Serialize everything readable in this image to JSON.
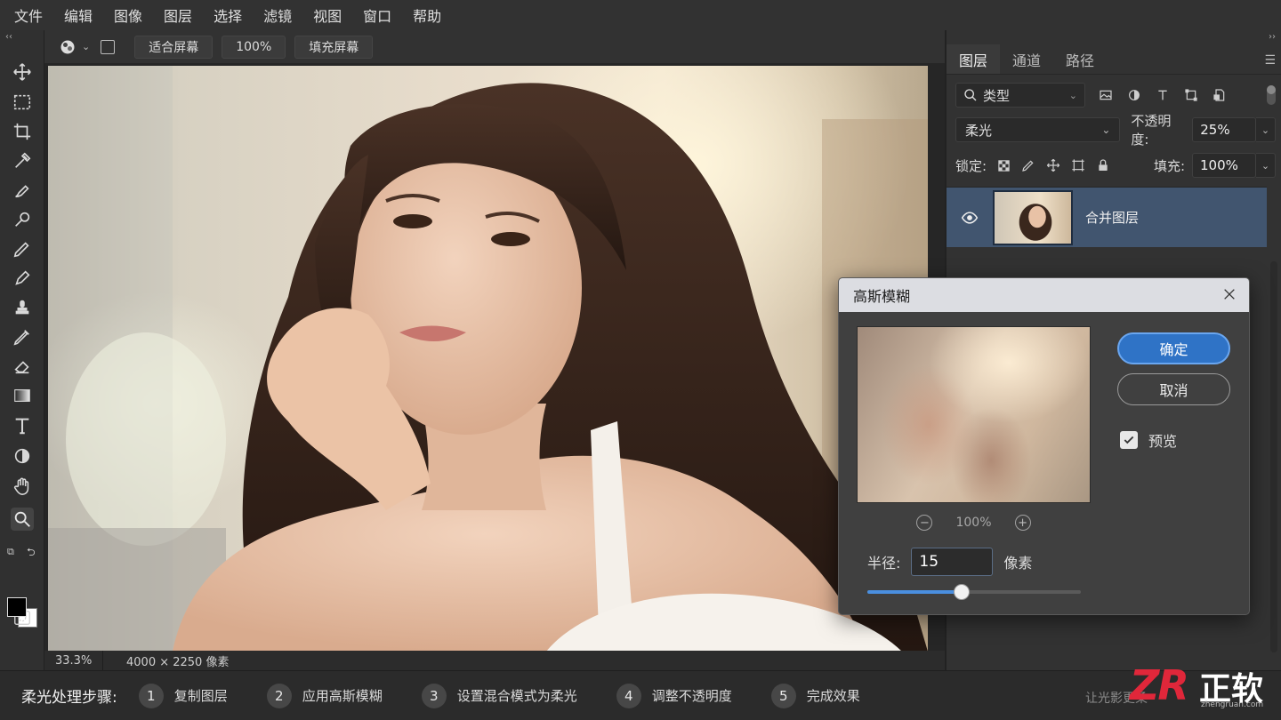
{
  "menu": [
    "文件",
    "编辑",
    "图像",
    "图层",
    "选择",
    "滤镜",
    "视图",
    "窗口",
    "帮助"
  ],
  "options_bar": {
    "fit_screen": "适合屏幕",
    "zoom_100": "100%",
    "fill_screen": "填充屏幕"
  },
  "toolbox": {
    "tools": [
      "move-icon",
      "marquee-icon",
      "crop-icon",
      "eyedropper-icon",
      "healing-brush-icon",
      "patch-icon",
      "brush-icon",
      "pencil-icon",
      "stamp-icon",
      "history-brush-icon",
      "eraser-icon",
      "gradient-icon",
      "type-icon",
      "dodge-icon",
      "hand-icon",
      "zoom-icon"
    ],
    "foreground_color": "#000000",
    "background_color": "#ffffff"
  },
  "status": {
    "zoom": "33.3%",
    "doc_size": "4000 × 2250 像素"
  },
  "layers_panel": {
    "tabs": [
      "图层",
      "通道",
      "路径"
    ],
    "filter_kind": "类型",
    "blend_mode": "柔光",
    "opacity_label": "不透明度:",
    "opacity": "25%",
    "lock_label": "锁定:",
    "fill_label": "填充:",
    "fill": "100%",
    "layer_name": "合并图层"
  },
  "dialog": {
    "title": "高斯模糊",
    "ok": "确定",
    "cancel": "取消",
    "preview_label": "预览",
    "preview_zoom": "100%",
    "radius_label": "半径:",
    "radius_value": "15",
    "radius_unit": "像素",
    "slider_fraction": 0.44
  },
  "steps": {
    "title": "柔光处理步骤:",
    "items": [
      {
        "num": "1",
        "label": "复制图层"
      },
      {
        "num": "2",
        "label": "应用高斯模糊"
      },
      {
        "num": "3",
        "label": "设置混合模式为柔光"
      },
      {
        "num": "4",
        "label": "调整不透明度"
      },
      {
        "num": "5",
        "label": "完成效果"
      }
    ],
    "tagline": "让光影更柔"
  },
  "watermark": {
    "brand": "ZR",
    "name": "正软",
    "url": "zhengruan.com"
  },
  "colors": {
    "accent": "#2f73c6",
    "selected_layer": "#41556f",
    "logo_red": "#e0273a"
  }
}
